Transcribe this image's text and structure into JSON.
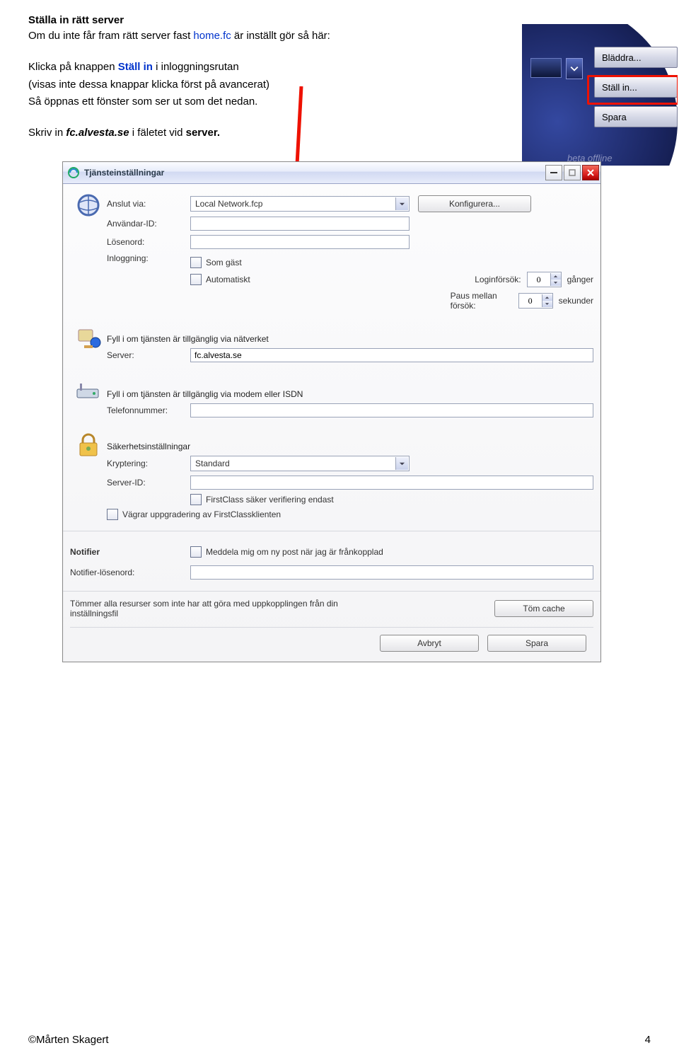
{
  "intro": {
    "heading": "Ställa in rätt server",
    "line1_a": "Om du inte får fram rätt server fast ",
    "line1_b": "home.fc",
    "line1_c": " är inställt gör så här:",
    "line2_a": "Klicka på knappen ",
    "line2_b": "Ställ in",
    "line2_c": " i inloggningsrutan",
    "line3": "(visas inte dessa knappar klicka först på avancerat)",
    "line4": "Så öppnas ett fönster som ser ut som det nedan.",
    "line5_a": "Skriv in ",
    "line5_b": "fc.alvesta.se",
    "line5_c": " i fäletet vid ",
    "line5_d": "server."
  },
  "bubble": {
    "btn1": "Bläddra...",
    "btn2": "Ställ in...",
    "btn3": "Spara",
    "offline": "beta offline"
  },
  "dialog": {
    "title": "Tjänsteinställningar",
    "anslut_label": "Anslut via:",
    "anslut_value": "Local Network.fcp",
    "konfigurera": "Konfigurera...",
    "userid_label": "Användar-ID:",
    "password_label": "Lösenord:",
    "inloggning_label": "Inloggning:",
    "cb_guest": "Som gäst",
    "cb_auto": "Automatiskt",
    "loginforsok_label": "Loginförsök:",
    "loginforsok_val": "0",
    "ganger": "gånger",
    "paus_label": "Paus mellan försök:",
    "paus_val": "0",
    "sekunder": "sekunder",
    "net_section": "Fyll i om tjänsten är tillgänglig via nätverket",
    "server_label": "Server:",
    "server_value": "fc.alvesta.se",
    "modem_section": "Fyll i om tjänsten är tillgänglig via modem eller ISDN",
    "tel_label": "Telefonnummer:",
    "security_section": "Säkerhetsinställningar",
    "krypt_label": "Kryptering:",
    "krypt_value": "Standard",
    "serverid_label": "Server-ID:",
    "cb_secure": "FirstClass säker verifiering endast",
    "cb_refuse": "Vägrar uppgradering av FirstClassklienten",
    "notifier_head": "Notifier",
    "cb_notify": "Meddela mig om ny post när jag är frånkopplad",
    "notifier_pw_label": "Notifier-lösenord:",
    "clear_text": "Tömmer alla resurser som inte har att göra med uppkopplingen från din inställningsfil",
    "clear_btn": "Töm cache",
    "avbryt": "Avbryt",
    "spara": "Spara"
  },
  "footer": {
    "left": "©Mårten Skagert",
    "right": "4"
  }
}
